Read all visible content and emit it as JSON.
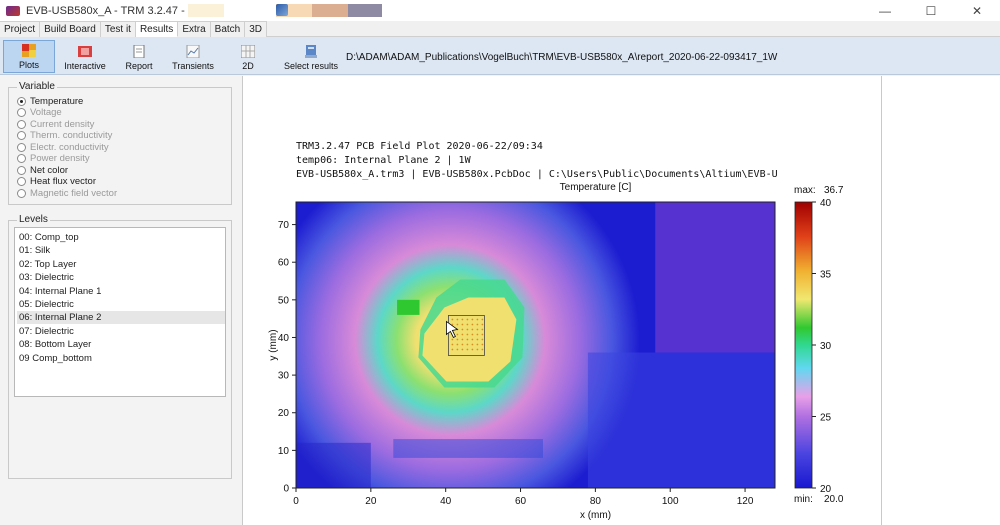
{
  "window": {
    "title": "EVB-USB580x_A - TRM 3.2.47 - D:",
    "controls": {
      "minimize": "—",
      "maximize": "☐",
      "close": "✕"
    }
  },
  "tabs": [
    {
      "label": "Project",
      "active": false
    },
    {
      "label": "Build Board",
      "active": false
    },
    {
      "label": "Test it",
      "active": false
    },
    {
      "label": "Results",
      "active": true
    },
    {
      "label": "Extra",
      "active": false
    },
    {
      "label": "Batch",
      "active": false
    },
    {
      "label": "3D",
      "active": false
    }
  ],
  "toolbar": {
    "buttons": [
      {
        "label": "Plots",
        "icon": "plots-icon",
        "active": true
      },
      {
        "label": "Interactive",
        "icon": "interactive-icon",
        "active": false
      },
      {
        "label": "Report",
        "icon": "report-icon",
        "active": false
      },
      {
        "label": "Transients",
        "icon": "transients-icon",
        "active": false
      },
      {
        "label": "2D",
        "icon": "grid-2d-icon",
        "active": false
      },
      {
        "label": "Select results",
        "icon": "select-results-icon",
        "active": false
      }
    ],
    "path": "D:\\ADAM\\ADAM_Publications\\VogelBuch\\TRM\\EVB-USB580x_A\\report_2020-06-22-093417_1W"
  },
  "variable": {
    "title": "Variable",
    "options": [
      {
        "label": "Temperature",
        "selected": true,
        "enabled": true
      },
      {
        "label": "Voltage",
        "selected": false,
        "enabled": false
      },
      {
        "label": "Current density",
        "selected": false,
        "enabled": false
      },
      {
        "label": "Therm. conductivity",
        "selected": false,
        "enabled": false
      },
      {
        "label": "Electr. conductivity",
        "selected": false,
        "enabled": false
      },
      {
        "label": "Power density",
        "selected": false,
        "enabled": false
      },
      {
        "label": "Net color",
        "selected": false,
        "enabled": true
      },
      {
        "label": "Heat flux vector",
        "selected": false,
        "enabled": true
      },
      {
        "label": "Magnetic field vector",
        "selected": false,
        "enabled": false
      }
    ]
  },
  "levels": {
    "title": "Levels",
    "items": [
      {
        "label": "00: Comp_top",
        "selected": false
      },
      {
        "label": "01: Silk",
        "selected": false
      },
      {
        "label": "02: Top Layer",
        "selected": false
      },
      {
        "label": "03: Dielectric",
        "selected": false
      },
      {
        "label": "04: Internal Plane 1",
        "selected": false
      },
      {
        "label": "05: Dielectric",
        "selected": false
      },
      {
        "label": "06: Internal Plane 2",
        "selected": true
      },
      {
        "label": "07: Dielectric",
        "selected": false
      },
      {
        "label": "08: Bottom Layer",
        "selected": false
      },
      {
        "label": "09 Comp_bottom",
        "selected": false
      }
    ]
  },
  "plot": {
    "line1": "TRM3.2.47    PCB Field Plot   2020-06-22/09:34",
    "line2": "temp06: Internal Plane 2  |  1W",
    "line3": "EVB-USB580x_A.trm3 | EVB-USB580x.PcbDoc | C:\\Users\\Public\\Documents\\Altium\\EVB-U"
  },
  "chart_data": {
    "type": "heatmap",
    "title": "Temperature [C]",
    "xlabel": "x (mm)",
    "ylabel": "y (mm)",
    "xlim": [
      0,
      128
    ],
    "ylim": [
      0,
      76
    ],
    "xticks": [
      0,
      20,
      40,
      60,
      80,
      100,
      120
    ],
    "yticks": [
      0,
      10,
      20,
      30,
      40,
      50,
      60,
      70
    ],
    "hotspot": {
      "x": 45,
      "y": 40,
      "value": 36.7
    },
    "colorbar": {
      "min": 20,
      "max": 40,
      "ticks": [
        20,
        25,
        30,
        35,
        40
      ],
      "max_label": "max:",
      "max_value": "36.7",
      "min_label": "min:",
      "min_value": "20.0"
    },
    "colors": [
      "#1c1cd0",
      "#3a5ce8",
      "#9c6ce0",
      "#d88ad8",
      "#78c8e8",
      "#3cd8b0",
      "#3cc83c",
      "#f0e878",
      "#f0c040",
      "#f08c20",
      "#e03018",
      "#b00000"
    ]
  }
}
